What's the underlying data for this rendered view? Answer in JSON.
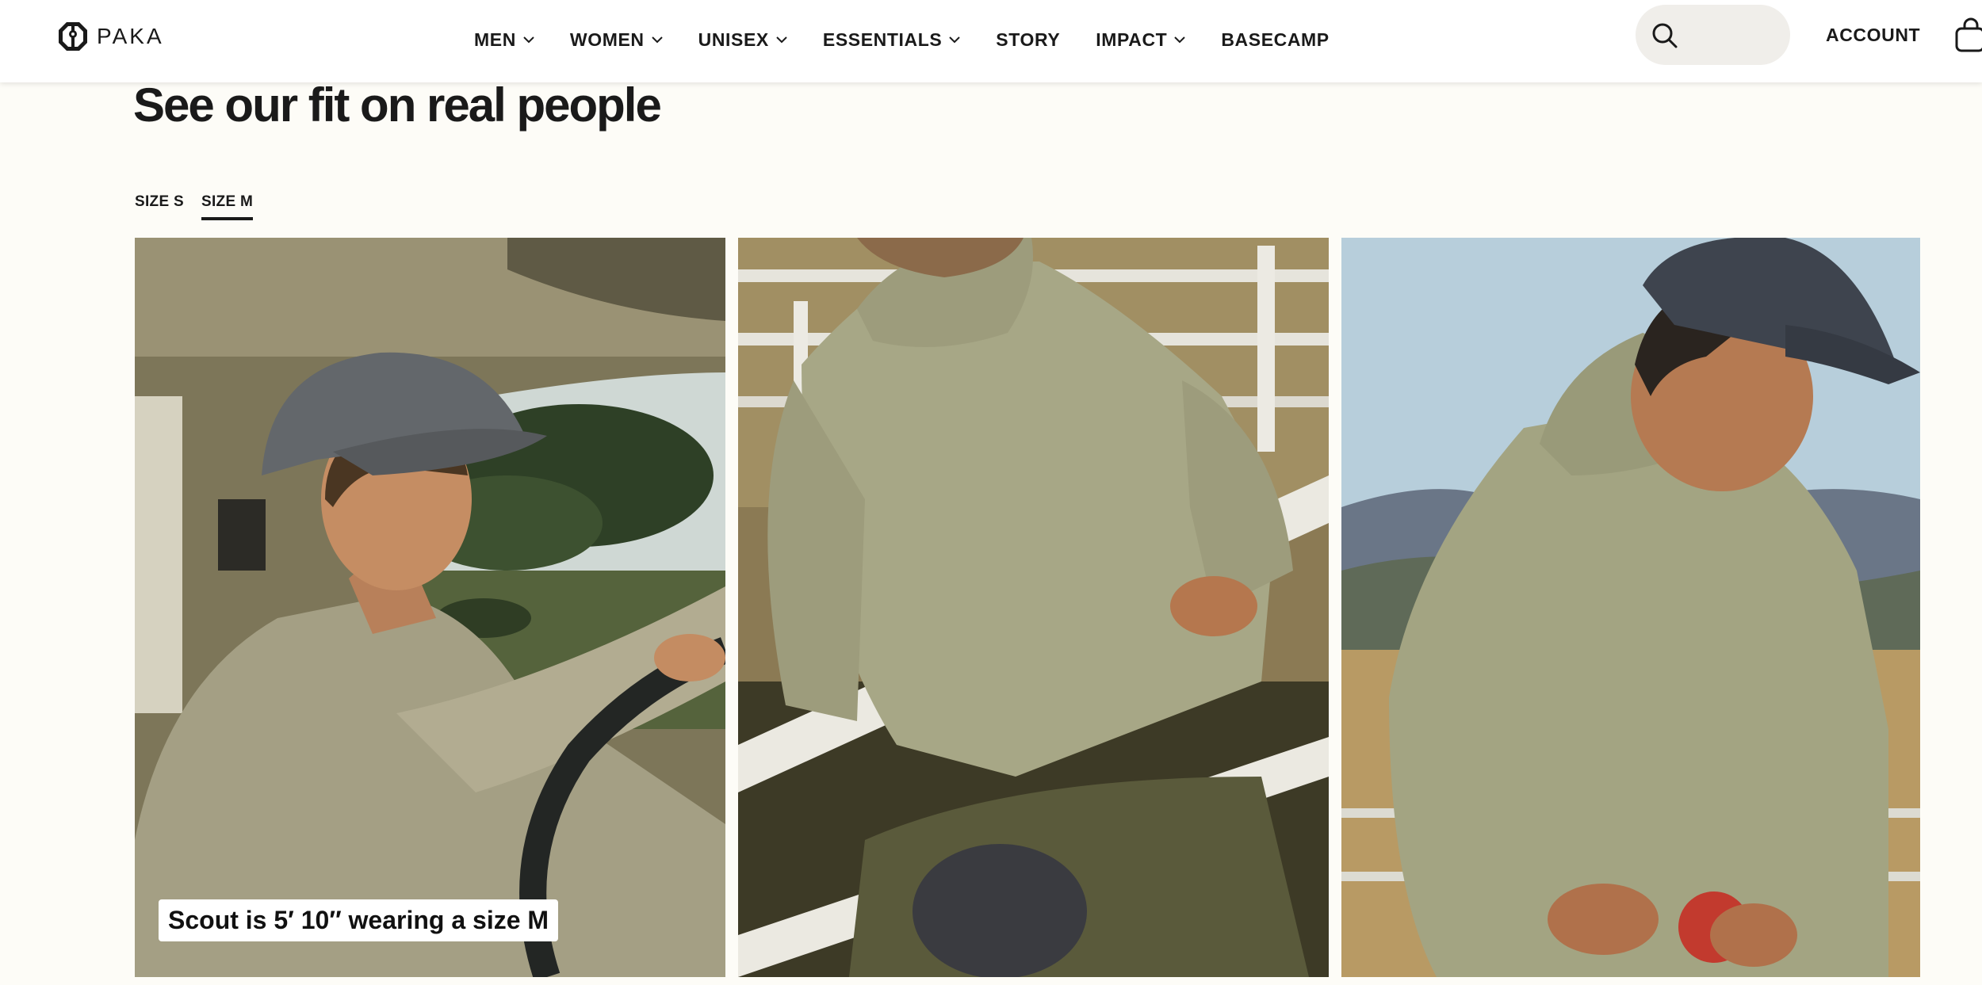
{
  "brand": {
    "name": "PAKA",
    "logo_icon": "paka-logo-icon"
  },
  "nav": {
    "items": [
      {
        "label": "MEN",
        "dropdown": true
      },
      {
        "label": "WOMEN",
        "dropdown": true
      },
      {
        "label": "UNISEX",
        "dropdown": true
      },
      {
        "label": "ESSENTIALS",
        "dropdown": true
      },
      {
        "label": "STORY",
        "dropdown": false
      },
      {
        "label": "IMPACT",
        "dropdown": true
      },
      {
        "label": "BASECAMP",
        "dropdown": false
      }
    ],
    "account_label": "ACCOUNT",
    "search_icon": "search-icon",
    "cart_icon": "cart-icon"
  },
  "section": {
    "title": "See our fit on real people",
    "tabs": [
      {
        "label": "SIZE S",
        "active": false
      },
      {
        "label": "SIZE M",
        "active": true
      }
    ]
  },
  "gallery": {
    "photos": [
      {
        "subject": "man in grey cap driving a truck",
        "caption": "Scout is 5′ 10″ wearing a size M"
      },
      {
        "subject": "man in olive hoodie leaning on white fence",
        "caption": ""
      },
      {
        "subject": "smiling man in navy cap holding an apple",
        "caption": ""
      }
    ]
  },
  "colors": {
    "page_bg": "#fdfcf7",
    "header_bg": "#ffffff",
    "text": "#1a1a1a",
    "search_bg": "#f0eeea",
    "hoodie_olive": "#a7a786"
  }
}
